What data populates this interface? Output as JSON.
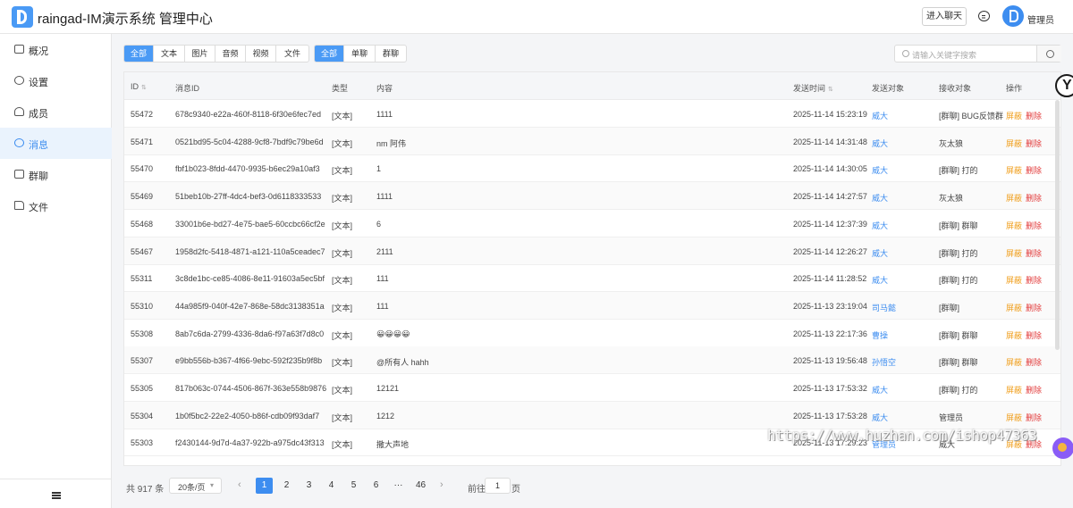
{
  "header": {
    "title": "raingad-IM演示系统 管理中心",
    "enter_chat": "进入聊天",
    "admin": "管理员"
  },
  "sidebar": {
    "items": [
      {
        "label": "概况"
      },
      {
        "label": "设置"
      },
      {
        "label": "成员"
      },
      {
        "label": "消息",
        "active": true
      },
      {
        "label": "群聊"
      },
      {
        "label": "文件"
      }
    ]
  },
  "filters": {
    "types": [
      "全部",
      "文本",
      "图片",
      "音频",
      "视频",
      "文件"
    ],
    "scopes": [
      "全部",
      "单聊",
      "群聊"
    ],
    "search_placeholder": "请输入关键字搜索"
  },
  "table": {
    "columns": {
      "id": "ID",
      "msg_id": "消息ID",
      "type": "类型",
      "content": "内容",
      "time": "发送时间",
      "sender": "发送对象",
      "receiver": "接收对象",
      "actions": "操作"
    },
    "block_label": "屏蔽",
    "delete_label": "删除",
    "rows": [
      {
        "id": "55472",
        "msg_id": "678c9340-e22a-460f-8118-6f30e6fec7ed",
        "type": "[文本]",
        "content": "1111",
        "time": "2025-11-14 15:23:19",
        "sender": "威大",
        "receiver": "[群聊] BUG反馈群"
      },
      {
        "id": "55471",
        "msg_id": "0521bd95-5c04-4288-9cf8-7bdf9c79be6d",
        "type": "[文本]",
        "content": "nm 阿伟",
        "time": "2025-11-14 14:31:48",
        "sender": "威大",
        "receiver": "灰太狼"
      },
      {
        "id": "55470",
        "msg_id": "fbf1b023-8fdd-4470-9935-b6ec29a10af3",
        "type": "[文本]",
        "content": "1",
        "time": "2025-11-14 14:30:05",
        "sender": "威大",
        "receiver": "[群聊] 打的"
      },
      {
        "id": "55469",
        "msg_id": "51beb10b-27ff-4dc4-bef3-0d6118333533",
        "type": "[文本]",
        "content": "1111",
        "time": "2025-11-14 14:27:57",
        "sender": "威大",
        "receiver": "灰太狼"
      },
      {
        "id": "55468",
        "msg_id": "33001b6e-bd27-4e75-bae5-60ccbc66cf2e",
        "type": "[文本]",
        "content": "6",
        "time": "2025-11-14 12:37:39",
        "sender": "威大",
        "receiver": "[群聊] 群聊"
      },
      {
        "id": "55467",
        "msg_id": "1958d2fc-5418-4871-a121-110a5ceadec7",
        "type": "[文本]",
        "content": "2111",
        "time": "2025-11-14 12:26:27",
        "sender": "威大",
        "receiver": "[群聊] 打的"
      },
      {
        "id": "55311",
        "msg_id": "3c8de1bc-ce85-4086-8e11-91603a5ec5bf",
        "type": "[文本]",
        "content": "111",
        "time": "2025-11-14 11:28:52",
        "sender": "威大",
        "receiver": "[群聊] 打的"
      },
      {
        "id": "55310",
        "msg_id": "44a985f9-040f-42e7-868e-58dc3138351a",
        "type": "[文本]",
        "content": "111",
        "time": "2025-11-13 23:19:04",
        "sender": "司马懿",
        "receiver": "[群聊]"
      },
      {
        "id": "55308",
        "msg_id": "8ab7c6da-2799-4336-8da6-f97a63f7d8c0",
        "type": "[文本]",
        "content": "😀😀😀😀",
        "time": "2025-11-13 22:17:36",
        "sender": "曹操",
        "receiver": "[群聊] 群聊"
      },
      {
        "id": "55307",
        "msg_id": "e9bb556b-b367-4f66-9ebc-592f235b9f8b",
        "type": "[文本]",
        "content": "@所有人 hahh",
        "time": "2025-11-13 19:56:48",
        "sender": "孙悟空",
        "receiver": "[群聊] 群聊"
      },
      {
        "id": "55305",
        "msg_id": "817b063c-0744-4506-867f-363e558b9876",
        "type": "[文本]",
        "content": "12121",
        "time": "2025-11-13 17:53:32",
        "sender": "威大",
        "receiver": "[群聊] 打的"
      },
      {
        "id": "55304",
        "msg_id": "1b0f5bc2-22e2-4050-b86f-cdb09f93daf7",
        "type": "[文本]",
        "content": "1212",
        "time": "2025-11-13 17:53:28",
        "sender": "威大",
        "receiver": "管理员"
      },
      {
        "id": "55303",
        "msg_id": "f2430144-9d7d-4a37-922b-a975dc43f313",
        "type": "[文本]",
        "content": "撒大声地",
        "time": "2025-11-13 17:29:23",
        "sender": "管理员",
        "receiver": "威大"
      }
    ]
  },
  "pagination": {
    "total": "共 917 条",
    "page_size": "20条/页",
    "prev": "‹",
    "next": "›",
    "pages": [
      "1",
      "2",
      "3",
      "4",
      "5",
      "6",
      "···",
      "46"
    ],
    "current": "1",
    "goto_label": "前往",
    "goto_value": "1",
    "page_suffix": "页"
  },
  "watermark": "https://www.huzhan.com/ishop47363"
}
